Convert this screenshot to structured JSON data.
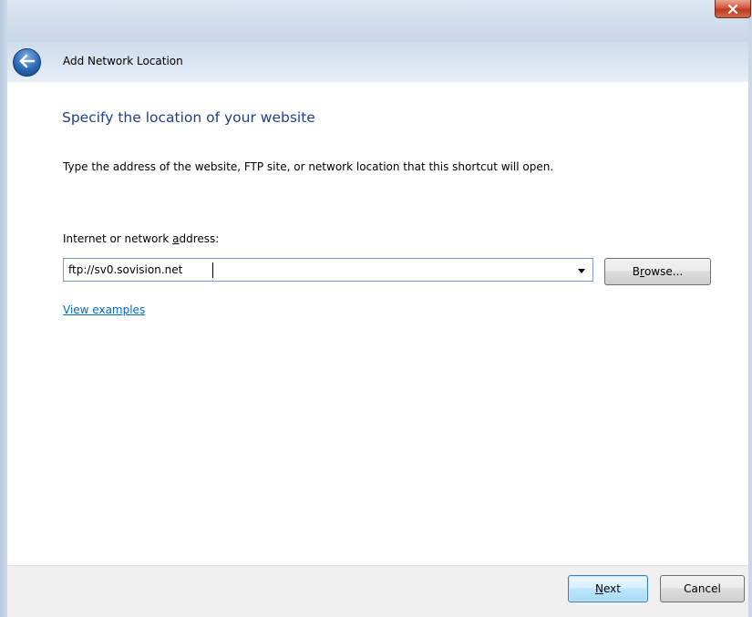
{
  "window": {
    "title": "Add Network Location"
  },
  "wizard": {
    "main_instruction": "Specify the location of your website",
    "description": "Type the address of the website, FTP site, or network location that this shortcut will open.",
    "address_label_before": "Internet or network ",
    "address_label_accel": "a",
    "address_label_after": "ddress:",
    "address_value": "ftp://sv0.sovision.net",
    "browse_before": "B",
    "browse_accel": "r",
    "browse_after": "owse...",
    "view_examples": "View examples"
  },
  "footer": {
    "next_accel": "N",
    "next_after": "ext",
    "cancel": "Cancel"
  },
  "colors": {
    "instruction": "#1e3f8a",
    "link": "#0066cc",
    "close_red": "#c0391c"
  },
  "icons": {
    "back": "back-arrow-icon",
    "close": "close-icon",
    "dropdown": "chevron-down-icon"
  }
}
